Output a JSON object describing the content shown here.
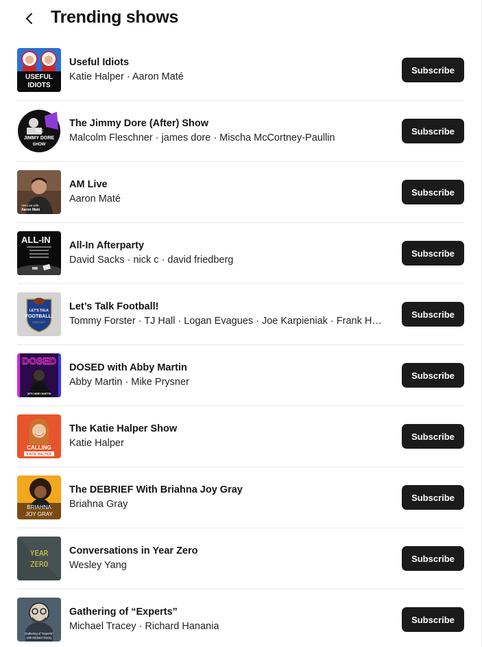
{
  "header": {
    "title": "Trending shows",
    "back_icon": "chevron-left-icon"
  },
  "shows": [
    {
      "title": "Useful Idiots",
      "hosts": "Katie Halper · Aaron Maté",
      "subscribe_label": "Subscribe",
      "art_text": [
        "USEFUL",
        "IDIOTS"
      ]
    },
    {
      "title": "The Jimmy Dore (After) Show",
      "hosts": "Malcolm Fleschner · james dore · Mischa McCortney-Paullin",
      "subscribe_label": "Subscribe",
      "art_text": [
        "THE",
        "JIMMY DORE",
        "SHOW"
      ]
    },
    {
      "title": "AM Live",
      "hosts": "Aaron Maté",
      "subscribe_label": "Subscribe",
      "art_text": [
        "AM Live with",
        "Aaron Maté"
      ]
    },
    {
      "title": "All-In Afterparty",
      "hosts": "David Sacks · nick c · david friedberg",
      "subscribe_label": "Subscribe",
      "art_text": [
        "ALL-IN"
      ]
    },
    {
      "title": "Let’s Talk Football!",
      "hosts": "Tommy Forster · TJ Hall · Logan Evagues · Joe Karpieniak · Frank Hartigan",
      "subscribe_label": "Subscribe",
      "art_text": [
        "LET'S TALK",
        "FOOTBALL!",
        "PODCAST"
      ]
    },
    {
      "title": "DOSED with Abby Martin",
      "hosts": "Abby Martin · Mike Prysner",
      "subscribe_label": "Subscribe",
      "art_text": [
        "DOSED",
        "WITH ABBY MARTIN"
      ]
    },
    {
      "title": "The Katie Halper Show",
      "hosts": "Katie Halper",
      "subscribe_label": "Subscribe",
      "art_text": [
        "CALLING",
        "KATIE HALPER"
      ]
    },
    {
      "title": "The DEBRIEF With Briahna Joy Gray",
      "hosts": "Briahna Gray",
      "subscribe_label": "Subscribe",
      "art_text": [
        "BRIAHNA",
        "JOY GRAY"
      ]
    },
    {
      "title": "Conversations in Year Zero",
      "hosts": "Wesley Yang",
      "subscribe_label": "Subscribe",
      "art_text": [
        "YEAR",
        "ZERO"
      ]
    },
    {
      "title": "Gathering of “Experts”",
      "hosts": "Michael Tracey · Richard Hanania",
      "subscribe_label": "Subscribe",
      "art_text": [
        "Gathering of \"Experts\"",
        "with Michael Tracey"
      ]
    }
  ],
  "colors": {
    "button_bg": "#1b1b1b",
    "button_text": "#ffffff",
    "divider": "#e9e9e9"
  }
}
